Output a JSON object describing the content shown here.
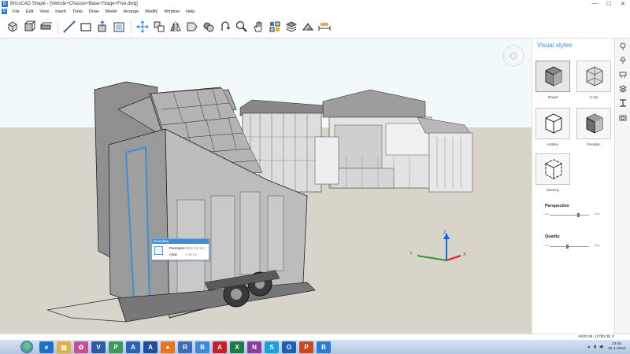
{
  "window": {
    "title": "BricsCAD Shape - [Vehicle+Chassis+Base+Stage+Five.dwg]",
    "controls": [
      "—",
      "☐",
      "✕"
    ]
  },
  "menu": {
    "items": [
      "File",
      "Edit",
      "View",
      "Insert",
      "Tools",
      "Draw",
      "Model",
      "Arrange",
      "Modify",
      "Window",
      "Help"
    ]
  },
  "toolbar": {
    "icons": [
      "box-icon",
      "cube-icon",
      "extrude-icon",
      "line-icon",
      "rectangle-icon",
      "push-pull-icon",
      "shell-icon",
      "move-icon",
      "copy-icon",
      "mirror-icon",
      "align-icon",
      "material-icon",
      "orbit-icon",
      "zoom-icon",
      "pan-icon",
      "components-icon",
      "layers-icon",
      "render-icon",
      "dimension-icon"
    ]
  },
  "tooltip": {
    "header": "Boundary",
    "perimeter_label": "Perimeter",
    "perimeter_value": "8062.43 mm",
    "area_label": "Area",
    "area_value": "1.48 m²"
  },
  "axes": {
    "x": "X",
    "y": "Y",
    "z": "Z"
  },
  "visual_styles": {
    "title": "Visual styles",
    "styles": [
      {
        "label": "Shape",
        "selected": true
      },
      {
        "label": "X-ray",
        "selected": false
      },
      {
        "label": "Hidden",
        "selected": false
      },
      {
        "label": "Realistic",
        "selected": false
      },
      {
        "label": "Sketchy",
        "selected": false
      }
    ],
    "perspective": {
      "label": "Perspective",
      "low": "Low",
      "high": "High",
      "level": 0.75
    },
    "quality": {
      "label": "Quality",
      "low": "Low",
      "high": "High",
      "level": 0.45
    }
  },
  "sidebar_icons": [
    "lightbulb-icon",
    "lamp-icon",
    "stamp-icon",
    "layers-icon",
    "beam-icon",
    "camera-icon"
  ],
  "status": {
    "coords": "-5633.39, 11780.09, 0"
  },
  "taskbar": {
    "apps": [
      {
        "name": "ie",
        "glyph": "e",
        "color": "#1e6fc8"
      },
      {
        "name": "explorer",
        "glyph": "▤",
        "color": "#e0b040"
      },
      {
        "name": "settings",
        "glyph": "✿",
        "color": "#c85090"
      },
      {
        "name": "visio",
        "glyph": "V",
        "color": "#2d5aa0"
      },
      {
        "name": "project",
        "glyph": "P",
        "color": "#3a9a5a"
      },
      {
        "name": "autocad",
        "glyph": "A",
        "color": "#2a62b8"
      },
      {
        "name": "autocad-2",
        "glyph": "A",
        "color": "#1f4e96"
      },
      {
        "name": "firefox",
        "glyph": "●",
        "color": "#e8761e"
      },
      {
        "name": "revit",
        "glyph": "R",
        "color": "#3a6fb8"
      },
      {
        "name": "bricscad",
        "glyph": "B",
        "color": "#3a8ad6"
      },
      {
        "name": "acrobat",
        "glyph": "A",
        "color": "#c8202a"
      },
      {
        "name": "excel",
        "glyph": "X",
        "color": "#1f7a44"
      },
      {
        "name": "onenote",
        "glyph": "N",
        "color": "#8a3aa0"
      },
      {
        "name": "skype",
        "glyph": "S",
        "color": "#18a0e0"
      },
      {
        "name": "outlook",
        "glyph": "O",
        "color": "#1f5fb0"
      },
      {
        "name": "powerpoint",
        "glyph": "P",
        "color": "#c84a1a"
      },
      {
        "name": "bricscad-2",
        "glyph": "B",
        "color": "#2a7ad6"
      }
    ],
    "time": "23:45",
    "date": "22-1-2018"
  }
}
